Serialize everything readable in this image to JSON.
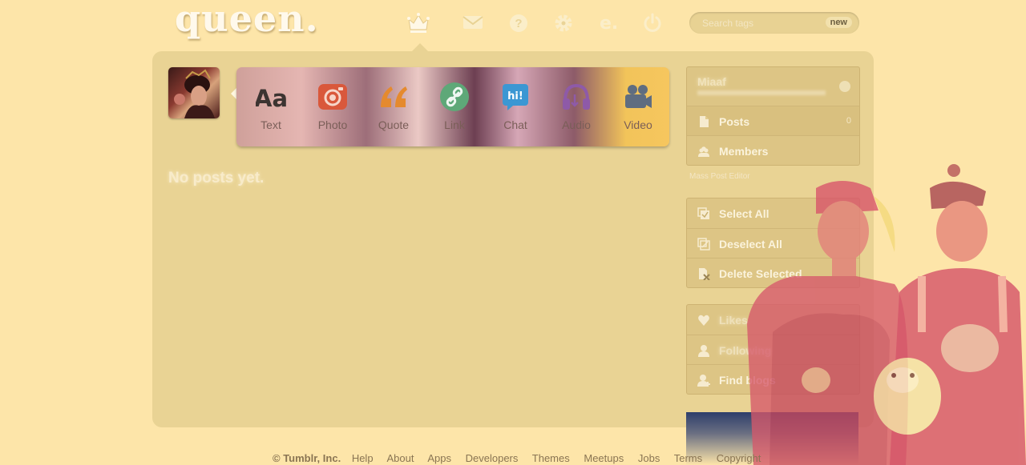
{
  "header": {
    "logo": "queen.",
    "nav": [
      {
        "name": "dashboard-crown-icon",
        "label": "Dashboard"
      },
      {
        "name": "messages-icon",
        "label": "Messages"
      },
      {
        "name": "help-icon",
        "label": "Help"
      },
      {
        "name": "settings-icon",
        "label": "Settings"
      },
      {
        "name": "edit-icon",
        "label": "e."
      },
      {
        "name": "logout-icon",
        "label": "Log out"
      }
    ],
    "search": {
      "placeholder": "Search tags",
      "badge": "new"
    }
  },
  "post_types": [
    {
      "label": "Text",
      "icon": "text-icon",
      "color": "#3c3431"
    },
    {
      "label": "Photo",
      "icon": "camera-icon",
      "color": "#d9583b"
    },
    {
      "label": "Quote",
      "icon": "quote-icon",
      "color": "#e58a2e"
    },
    {
      "label": "Link",
      "icon": "link-icon",
      "color": "#5ea878"
    },
    {
      "label": "Chat",
      "icon": "chat-icon",
      "color": "#3b97d3"
    },
    {
      "label": "Audio",
      "icon": "headphones-icon",
      "color": "#8e5aa8"
    },
    {
      "label": "Video",
      "icon": "video-icon",
      "color": "#5f6d80"
    }
  ],
  "main": {
    "empty_message": "No posts yet."
  },
  "sidebar": {
    "blog_name": "Miaaf",
    "blog_items": [
      {
        "label": "Posts",
        "icon": "document-icon",
        "count": "0"
      },
      {
        "label": "Members",
        "icon": "members-icon",
        "count": ""
      }
    ],
    "mass_label": "Mass Post Editor",
    "mass_items": [
      {
        "label": "Select All",
        "icon": "select-all-icon"
      },
      {
        "label": "Deselect All",
        "icon": "deselect-all-icon"
      },
      {
        "label": "Delete Selected",
        "icon": "delete-selected-icon"
      }
    ],
    "account_items": [
      {
        "label": "Likes",
        "icon": "heart-icon"
      },
      {
        "label": "Following",
        "icon": "person-icon"
      },
      {
        "label": "Find blogs",
        "icon": "find-blogs-icon"
      }
    ]
  },
  "footer": {
    "copyright": "© Tumblr, Inc.",
    "links": [
      "Help",
      "About",
      "Apps",
      "Developers",
      "Themes",
      "Meetups",
      "Jobs",
      "Terms",
      "Copyright"
    ]
  },
  "colors": {
    "background": "#fde5a9",
    "panel": "#e9d394",
    "sidebar": "#ddc585"
  }
}
